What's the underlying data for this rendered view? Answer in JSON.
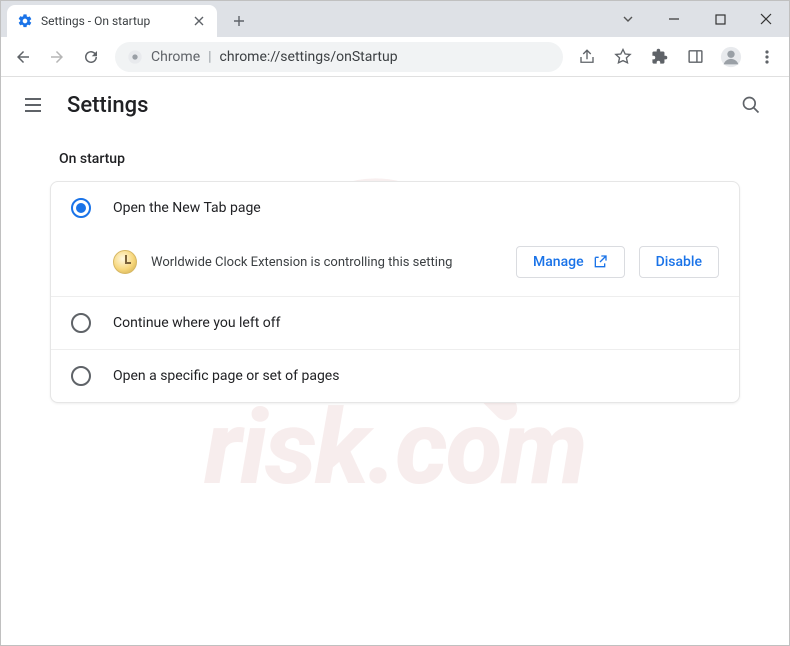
{
  "tab": {
    "title": "Settings - On startup"
  },
  "omnibox": {
    "origin": "Chrome",
    "url": "chrome://settings/onStartup"
  },
  "header": {
    "title": "Settings"
  },
  "section": {
    "title": "On startup"
  },
  "options": [
    {
      "label": "Open the New Tab page",
      "selected": true
    },
    {
      "label": "Continue where you left off",
      "selected": false
    },
    {
      "label": "Open a specific page or set of pages",
      "selected": false
    }
  ],
  "notice": {
    "extension_name": "Worldwide Clock Extension",
    "text": "Worldwide Clock Extension is controlling this setting",
    "manage_label": "Manage",
    "disable_label": "Disable"
  },
  "watermark": {
    "text": "risk.com"
  }
}
